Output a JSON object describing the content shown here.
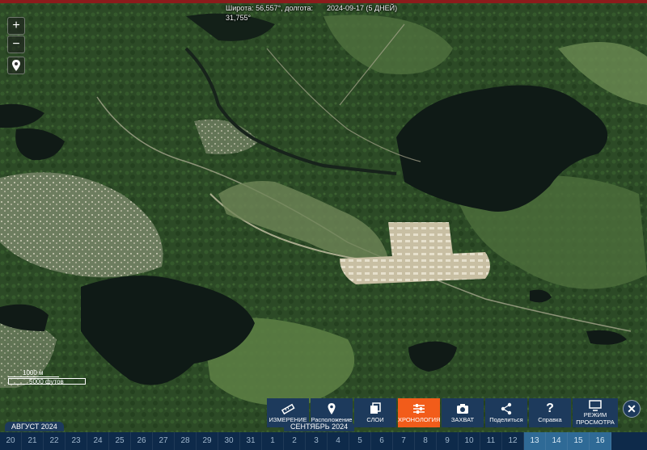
{
  "header": {
    "coords_line1": "Широта: 56,557°, долгота:",
    "coords_line2": "31,755°",
    "date": "2024-09-17 (5 ДНЕЙ)"
  },
  "map_controls": {
    "zoom_in": "+",
    "zoom_out": "−",
    "location_icon": "map-pin-icon"
  },
  "scale": {
    "metric": "1000 м",
    "imperial": "5000 футов"
  },
  "toolbar": [
    {
      "label": "ИЗМЕРЕНИЕ",
      "icon": "ruler-icon",
      "active": false
    },
    {
      "label": "Расположение",
      "icon": "map-pin-icon",
      "active": false
    },
    {
      "label": "СЛОИ",
      "icon": "layers-icon",
      "active": false
    },
    {
      "label": "ХРОНОЛОГИЯ",
      "icon": "sliders-icon",
      "active": true
    },
    {
      "label": "ЗАХВАТ",
      "icon": "camera-icon",
      "active": false
    },
    {
      "label": "Поделиться",
      "icon": "share-icon",
      "active": false
    },
    {
      "label": "Справка",
      "icon": "help-icon",
      "active": false
    },
    {
      "label": "РЕЖИМ ПРОСМОТРА",
      "icon": "monitor-icon",
      "active": false
    }
  ],
  "close_label": "✕",
  "timeline": {
    "month_left": "АВГУСТ 2024",
    "month_right": "СЕНТЯБРЬ 2024",
    "days": [
      "20",
      "21",
      "22",
      "23",
      "24",
      "25",
      "26",
      "27",
      "28",
      "29",
      "30",
      "31",
      "1",
      "2",
      "3",
      "4",
      "5",
      "6",
      "7",
      "8",
      "9",
      "10",
      "11",
      "12",
      "13",
      "14",
      "15",
      "16"
    ],
    "selected_days": [
      "13",
      "14",
      "15",
      "16"
    ]
  },
  "colors": {
    "accent_active": "#f25c1a",
    "toolbar_bg": "#1d3a5c",
    "timeline_bg": "#0e2a4a"
  }
}
